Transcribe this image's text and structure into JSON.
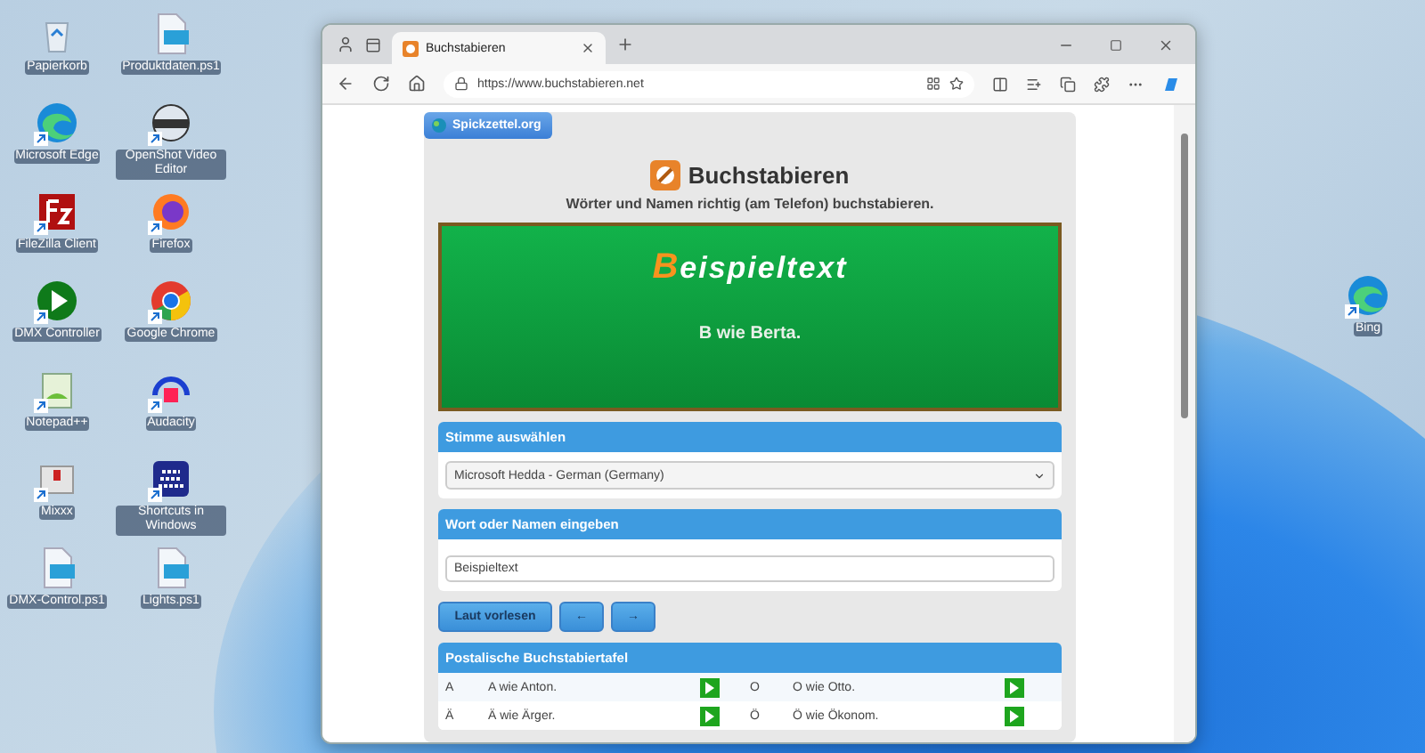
{
  "desktop": {
    "icons": [
      {
        "label": "Papierkorb",
        "kind": "bin",
        "shortcut": false
      },
      {
        "label": "Produktdaten.ps1",
        "kind": "script",
        "shortcut": false
      },
      {
        "label": "Microsoft Edge",
        "kind": "edge",
        "shortcut": true
      },
      {
        "label": "OpenShot Video Editor",
        "kind": "camera",
        "shortcut": true
      },
      {
        "label": "FileZilla Client",
        "kind": "filezilla",
        "shortcut": true
      },
      {
        "label": "Firefox",
        "kind": "firefox",
        "shortcut": true
      },
      {
        "label": "DMX Controller",
        "kind": "play",
        "shortcut": true
      },
      {
        "label": "Google Chrome",
        "kind": "chrome",
        "shortcut": true
      },
      {
        "label": "Notepad++",
        "kind": "notepad",
        "shortcut": true
      },
      {
        "label": "Audacity",
        "kind": "headphones",
        "shortcut": true
      },
      {
        "label": "Mixxx",
        "kind": "mixer",
        "shortcut": true
      },
      {
        "label": "Shortcuts in Windows",
        "kind": "keypad",
        "shortcut": true
      },
      {
        "label": "DMX-Control.ps1",
        "kind": "script",
        "shortcut": false
      },
      {
        "label": "Lights.ps1",
        "kind": "script",
        "shortcut": false
      }
    ],
    "side_icon": {
      "label": "Bing",
      "kind": "edge",
      "shortcut": true
    }
  },
  "browser": {
    "tab": {
      "title": "Buchstabieren",
      "selected": true
    },
    "address": "https://www.buchstabieren.net"
  },
  "page": {
    "badge": "Spickzettel.org",
    "title": "Buchstabieren",
    "subtitle": "Wörter und Namen richtig (am Telefon) buchstabieren.",
    "board": {
      "word": "Beispieltext",
      "spelling": "B wie Berta."
    },
    "voice_panel": {
      "header": "Stimme auswählen",
      "selected_voice": "Microsoft Hedda - German (Germany)"
    },
    "word_panel": {
      "header": "Wort oder Namen eingeben",
      "value": "Beispieltext"
    },
    "buttons": [
      "Laut vorlesen",
      "←",
      "→"
    ],
    "table": {
      "header": "Postalische Buchstabiertafel",
      "rows": [
        {
          "letter": "A",
          "word": "A wie Anton.",
          "letter_2": "O",
          "word_2": "O wie Otto."
        },
        {
          "letter": "Ä",
          "word": "Ä wie Ärger.",
          "letter_2": "Ö",
          "word_2": "Ö wie Ökonom."
        }
      ]
    }
  }
}
